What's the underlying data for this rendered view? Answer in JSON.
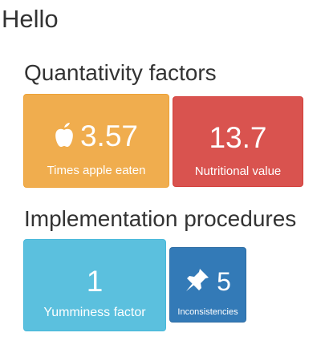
{
  "page": {
    "title": "Hello"
  },
  "sections": [
    {
      "title": "Quantativity factors",
      "tiles": [
        {
          "value": "3.57",
          "label": "Times apple eaten",
          "icon": "apple-icon",
          "color": "#f0ad4e"
        },
        {
          "value": "13.7",
          "label": "Nutritional value",
          "color": "#d9534f"
        }
      ]
    },
    {
      "title": "Implementation procedures",
      "tiles": [
        {
          "value": "1",
          "label": "Yumminess factor",
          "color": "#5bc0de"
        },
        {
          "value": "5",
          "label": "Inconsistencies",
          "icon": "pushpin-icon",
          "color": "#337ab7"
        }
      ]
    }
  ]
}
